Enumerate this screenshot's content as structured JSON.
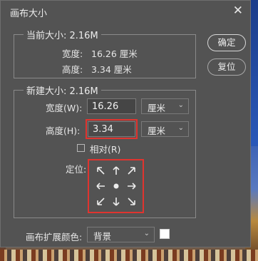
{
  "window": {
    "title": "画布大小"
  },
  "buttons": {
    "ok": "确定",
    "reset": "复位"
  },
  "current_size": {
    "legend": "当前大小: 2.16M",
    "width_label": "宽度:",
    "width_value": "16.26 厘米",
    "height_label": "高度:",
    "height_value": "3.34 厘米"
  },
  "new_size": {
    "legend": "新建大小: 2.16M",
    "width_label": "宽度(W):",
    "width_value": "16.26",
    "width_unit": "厘米",
    "height_label": "高度(H):",
    "height_value": "3.34",
    "height_unit": "厘米",
    "relative_label": "相对(R)",
    "relative_checked": false,
    "anchor_label": "定位:"
  },
  "extension_color": {
    "label": "画布扩展颜色:",
    "value": "背景",
    "swatch": "#ffffff"
  },
  "colors": {
    "highlight": "#e0342f",
    "dialog_bg": "#535353"
  },
  "icons": [
    "close-icon",
    "chevron-down-icon",
    "arrow-icons",
    "anchor-dot-icon"
  ]
}
